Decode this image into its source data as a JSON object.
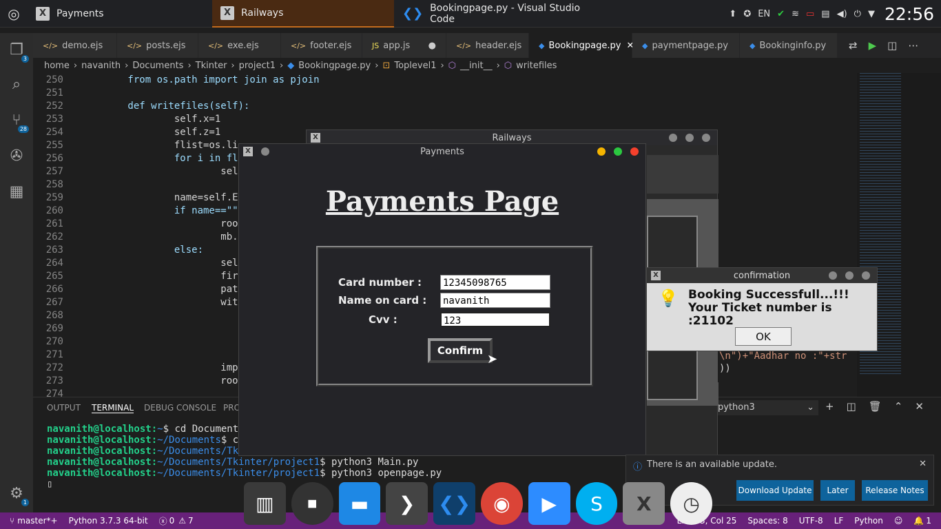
{
  "taskbar": {
    "tasks": [
      "Payments",
      "Railways",
      "Bookingpage.py - Visual Studio Code"
    ],
    "lang": "EN",
    "clock": "22:56"
  },
  "tabs": [
    "demo.ejs",
    "posts.ejs",
    "exe.ejs",
    "footer.ejs",
    "app.js",
    "header.ejs",
    "Bookingpage.py",
    "paymentpage.py",
    "Bookinginfo.py"
  ],
  "breadcrumb": [
    "home",
    "navanith",
    "Documents",
    "Tkinter",
    "project1",
    "Bookingpage.py",
    "Toplevel1",
    "__init__",
    "writefiles"
  ],
  "activity": {
    "explorer_badge": "3",
    "scm_badge": "28",
    "settings_badge": "1"
  },
  "editor": {
    "line_numbers": [
      "250",
      "251",
      "252",
      "253",
      "254",
      "255",
      "256",
      "257",
      "258",
      "259",
      "260",
      "261",
      "262",
      "263",
      "264",
      "265",
      "266",
      "267",
      "268",
      "269",
      "270",
      "271",
      "272",
      "273",
      "274"
    ],
    "lines": [
      "        from os.path import join as pjoin",
      "",
      "        def writefiles(self):",
      "                self.x=1",
      "                self.z=1",
      "                flist=os.li",
      "                for i in fl",
      "                        sel",
      "",
      "                name=self.E",
      "                if name==\"\"",
      "                        roo",
      "                        mb.",
      "                else:",
      "                        sel",
      "                        fir",
      "                        pat",
      "                        wit",
      "",
      "",
      "",
      "",
      "                        impo",
      "                        roo",
      ""
    ]
  },
  "panel": {
    "tabs": [
      "OUTPUT",
      "TERMINAL",
      "DEBUG CONSOLE",
      "PRO"
    ],
    "python_select": "python3",
    "terminal": [
      {
        "prompt": "navanith@localhost:",
        "path": "~",
        "cmd": "$ cd Documents"
      },
      {
        "prompt": "navanith@localhost:",
        "path": "~/Documents",
        "cmd": "$ cd"
      },
      {
        "prompt": "navanith@localhost:",
        "path": "~/Documents/Tki",
        "cmd": ""
      },
      {
        "prompt": "navanith@localhost:",
        "path": "~/Documents/Tkinter/project1",
        "cmd": "$ python3 Main.py"
      },
      {
        "prompt": "navanith@localhost:",
        "path": "~/Documents/Tkinter/project1",
        "cmd": "$ python3 openpage.py"
      }
    ]
  },
  "railways": {
    "title": "Railways"
  },
  "payments": {
    "title": "Payments",
    "heading": "Payments Page",
    "card_label": "Card number :",
    "card_value": "12345098765",
    "name_label": "Name on card :",
    "name_value": "navanith",
    "cvv_label": "Cvv :",
    "cvv_value": "123",
    "confirm": "Confirm"
  },
  "confirmation": {
    "title": "confirmation",
    "line1": "Booking Successfull...!!!",
    "line2": "Your Ticket number is :21102",
    "ok": "OK"
  },
  "snippet": {
    "line1": "\\n\")+\"Aadhar no :\"+str",
    "line2": "))"
  },
  "update": {
    "text": "There is an available update.",
    "download": "Download Update",
    "later": "Later",
    "notes": "Release Notes"
  },
  "status": {
    "branch": "master*+",
    "python": "Python 3.7.3 64-bit",
    "errors": "0",
    "warnings": "7",
    "position": "Ln 253, Col 25",
    "spaces": "Spaces: 8",
    "encoding": "UTF-8",
    "eol": "LF",
    "lang": "Python",
    "bell": "1"
  },
  "colors": {
    "statusbar": "#68217a",
    "accent": "#0e639c"
  }
}
